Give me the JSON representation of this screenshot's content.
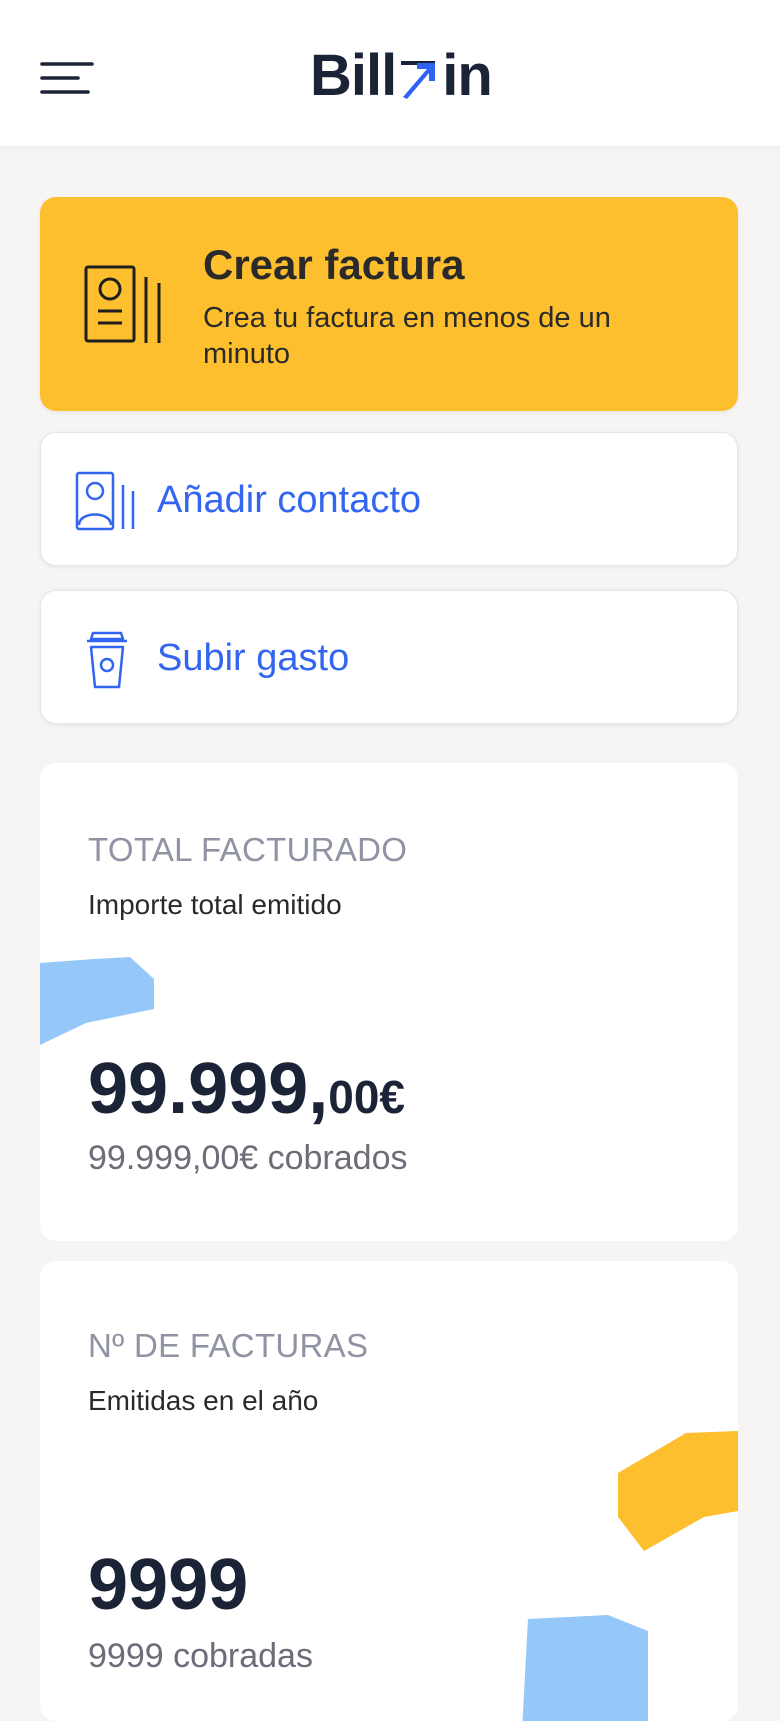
{
  "header": {
    "logo_text_left": "Bill",
    "logo_text_right": "in",
    "menu_icon": "hamburger-menu-icon"
  },
  "create_invoice": {
    "title": "Crear factura",
    "subtitle": "Crea tu factura en menos de un minuto",
    "icon": "invoice-icon"
  },
  "actions": [
    {
      "label": "Añadir contacto",
      "icon": "contact-card-icon"
    },
    {
      "label": "Subir gasto",
      "icon": "coffee-cup-icon"
    }
  ],
  "total_billed": {
    "heading": "TOTAL FACTURADO",
    "subheading": "Importe total emitido",
    "amount_main": "99.999,",
    "amount_cents": "00€",
    "collected": "99.999,00€ cobrados"
  },
  "invoice_count": {
    "heading": "Nº DE FACTURAS",
    "subheading": "Emitidas en el año",
    "count": "9999",
    "collected": "9999 cobradas"
  },
  "colors": {
    "accent_yellow": "#fdbf2d",
    "accent_blue": "#3366f0",
    "blob_blue": "#95c8f8",
    "text_dark": "#1b2337",
    "background": "#f6f5f4"
  }
}
